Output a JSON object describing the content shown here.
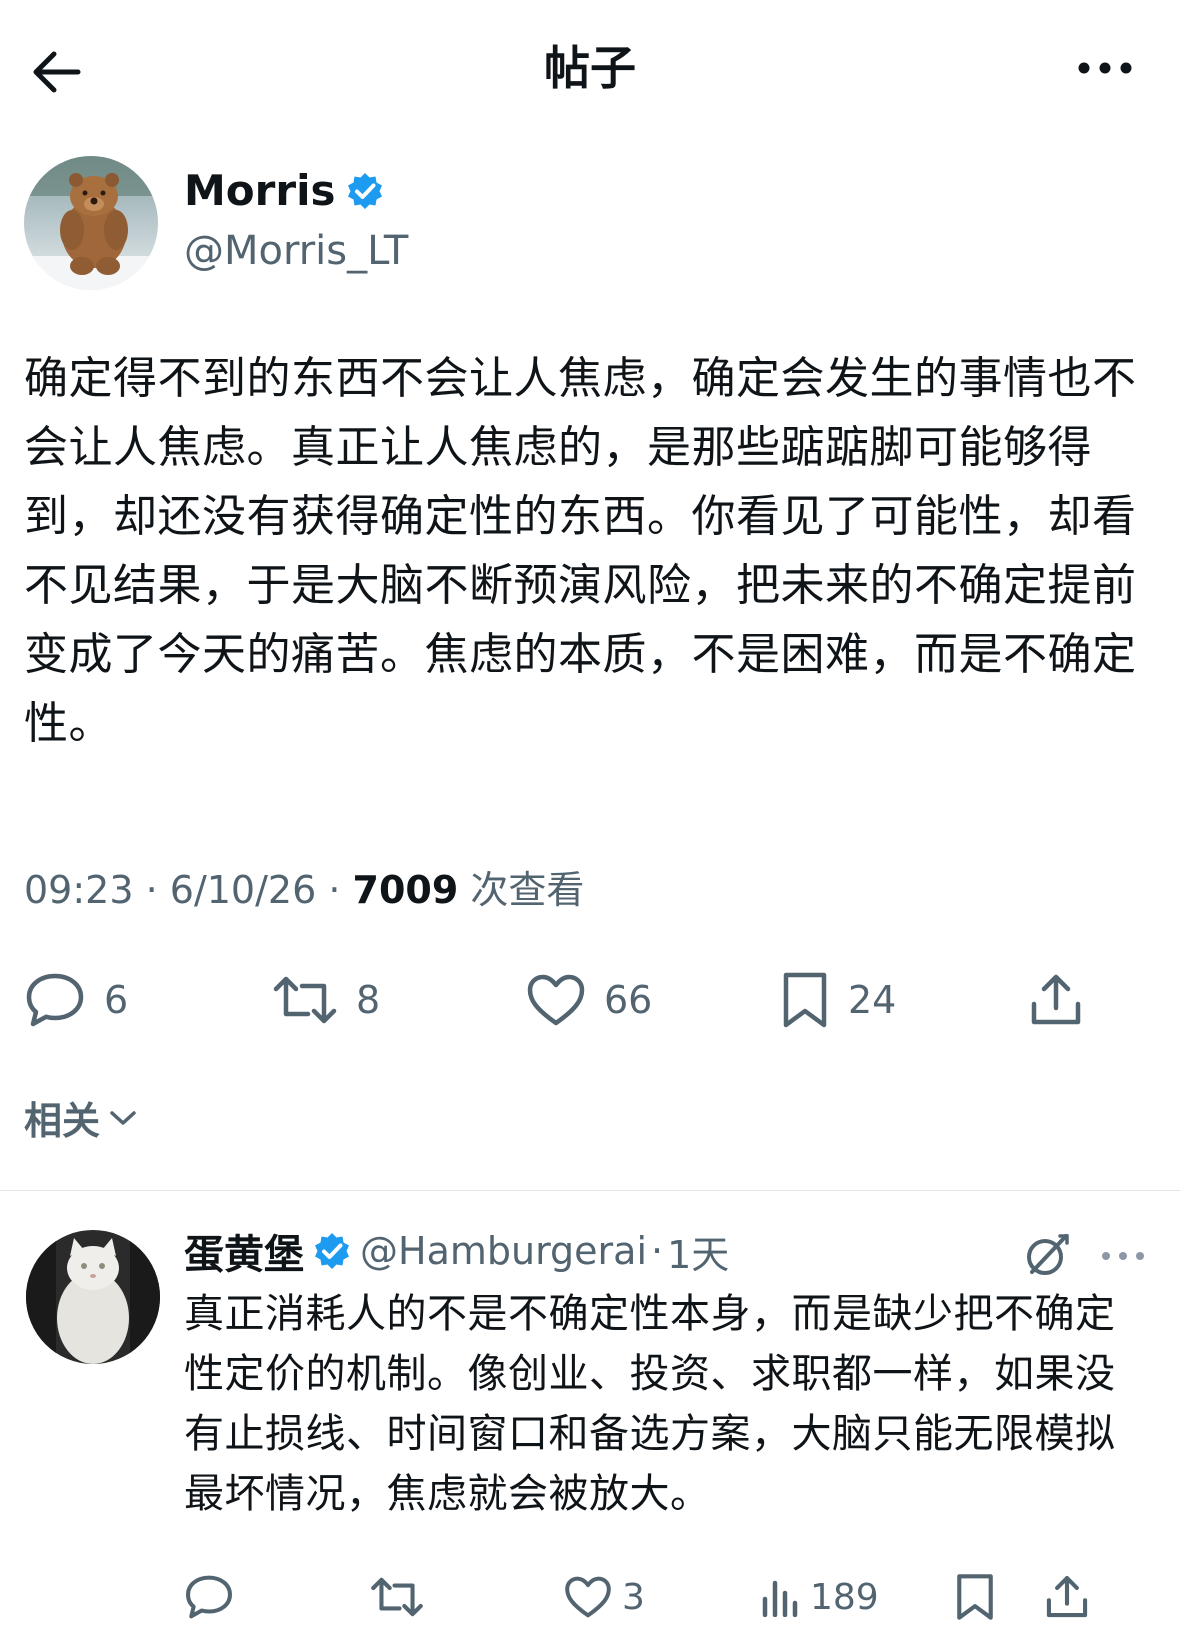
{
  "header": {
    "title": "帖子",
    "back_icon": "arrow-left-icon",
    "more_icon": "more-horizontal-icon"
  },
  "post": {
    "author": {
      "name": "Morris",
      "handle": "@Morris_LT",
      "verified": true
    },
    "text": "确定得不到的东西不会让人焦虑，确定会发生的事情也不会让人焦虑。真正让人焦虑的，是那些踮踮脚可能够得到，却还没有获得确定性的东西。你看见了可能性，却看不见结果，于是大脑不断预演风险，把未来的不确定提前变成了今天的痛苦。焦虑的本质，不是困难，而是不确定性。",
    "time": "09:23",
    "date": "6/10/26",
    "separator": " · ",
    "views": "7009",
    "views_label": " 次查看",
    "actions": {
      "replies": "6",
      "reposts": "8",
      "likes": "66",
      "bookmarks": "24"
    }
  },
  "related": {
    "label": "相关"
  },
  "reply": {
    "name": "蛋黄堡",
    "handle": "@Hamburgerai",
    "time": "1天",
    "text": "真正消耗人的不是不确定性本身，而是缺少把不确定性定价的机制。像创业、投资、求职都一样，如果没有止损线、时间窗口和备选方案，大脑只能无限模拟最坏情况，焦虑就会被放大。",
    "actions": {
      "likes": "3",
      "views": "189"
    }
  },
  "colors": {
    "text": "#0f1419",
    "secondary": "#536471",
    "verified": "#1d9bf0"
  }
}
